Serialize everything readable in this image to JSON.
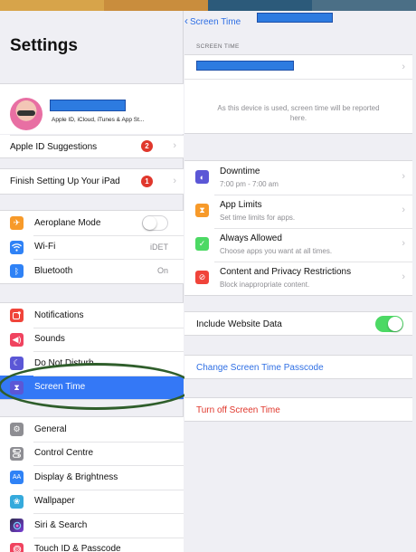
{
  "wallpaper_colors": [
    "#d7a44a",
    "#c98d3d",
    "#2c5a7a",
    "#4b6f86"
  ],
  "sidebar": {
    "title": "Settings",
    "profile": {
      "subtitle": "Apple ID, iCloud, iTunes & App St...",
      "avatar_icon": "memoji-avatar"
    },
    "apple_id_suggestions": {
      "label": "Apple ID Suggestions",
      "badge": "2"
    },
    "finish_setup": {
      "label": "Finish Setting Up Your iPad",
      "badge": "1"
    },
    "connectivity": [
      {
        "label": "Aeroplane Mode",
        "icon": "airplane-icon",
        "color": "#f79a2a",
        "toggle": "off"
      },
      {
        "label": "Wi-Fi",
        "value": "iDET",
        "icon": "wifi-icon",
        "color": "#2f82f6"
      },
      {
        "label": "Bluetooth",
        "value": "On",
        "icon": "bluetooth-icon",
        "color": "#2f82f6"
      }
    ],
    "notifications_group": [
      {
        "label": "Notifications",
        "icon": "notifications-icon",
        "color": "#f0443a"
      },
      {
        "label": "Sounds",
        "icon": "sounds-icon",
        "color": "#f0435f"
      },
      {
        "label": "Do Not Disturb",
        "icon": "moon-icon",
        "color": "#5b57d6"
      },
      {
        "label": "Screen Time",
        "icon": "hourglass-icon",
        "color": "#5b57d6",
        "selected": true
      }
    ],
    "general_group": [
      {
        "label": "General",
        "icon": "gear-icon",
        "color": "#8e8e93"
      },
      {
        "label": "Control Centre",
        "icon": "control-centre-icon",
        "color": "#8e8e93"
      },
      {
        "label": "Display & Brightness",
        "icon": "display-icon",
        "color": "#2f82f6"
      },
      {
        "label": "Wallpaper",
        "icon": "wallpaper-icon",
        "color": "#35aadc"
      },
      {
        "label": "Siri & Search",
        "icon": "siri-icon",
        "color": "#2b2b4b"
      },
      {
        "label": "Touch ID & Passcode",
        "icon": "fingerprint-icon",
        "color": "#f0435f"
      }
    ]
  },
  "detail": {
    "back_label": "Screen Time",
    "section_header": "SCREEN TIME",
    "device_note": "As this device is used, screen time will be reported here.",
    "options": [
      {
        "title": "Downtime",
        "subtitle": "7:00 pm - 7:00 am",
        "icon": "downtime-icon",
        "color": "#5b57d6"
      },
      {
        "title": "App Limits",
        "subtitle": "Set time limits for apps.",
        "icon": "hourglass-icon",
        "color": "#f79a2a"
      },
      {
        "title": "Always Allowed",
        "subtitle": "Choose apps you want at all times.",
        "icon": "checkmark-icon",
        "color": "#4cd964"
      },
      {
        "title": "Content and Privacy Restrictions",
        "subtitle": "Block inappropriate content.",
        "icon": "restriction-icon",
        "color": "#f0443a"
      }
    ],
    "include_website_data": {
      "label": "Include Website Data",
      "toggle": "on"
    },
    "change_passcode": "Change Screen Time Passcode",
    "turn_off": "Turn off Screen Time",
    "link_color": "#2f6fe4",
    "destructive_color": "#e0372c"
  }
}
